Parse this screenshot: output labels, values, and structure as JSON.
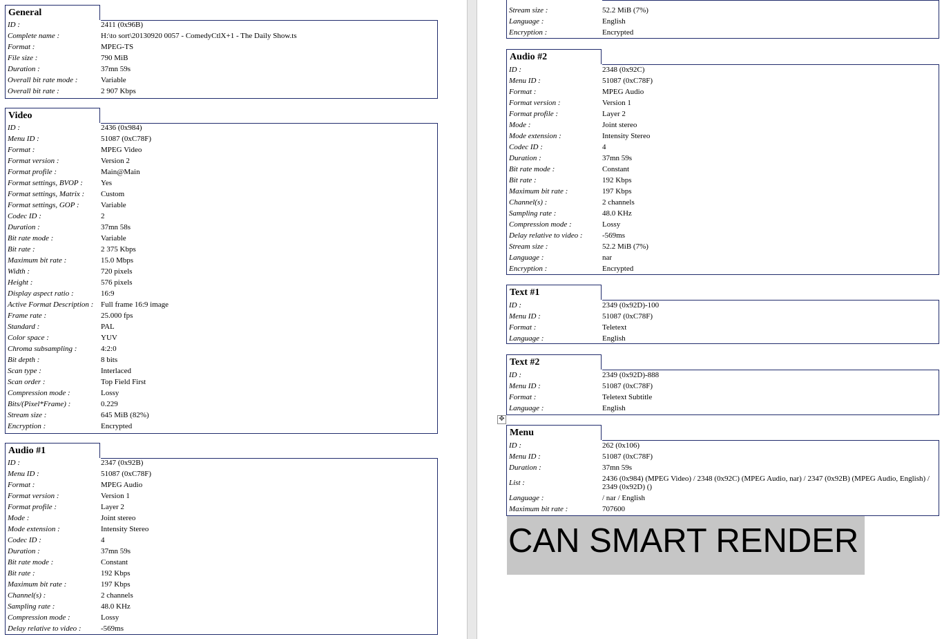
{
  "left_page": {
    "general": {
      "title": "General",
      "rows": [
        {
          "k": "ID :",
          "v": "2411 (0x96B)"
        },
        {
          "k": "Complete name :",
          "v": "H:\\to sort\\20130920 0057 - ComedyCtlX+1 - The Daily Show.ts"
        },
        {
          "k": "Format :",
          "v": "MPEG-TS"
        },
        {
          "k": "File size :",
          "v": "790 MiB"
        },
        {
          "k": "Duration :",
          "v": "37mn 59s"
        },
        {
          "k": "Overall bit rate mode :",
          "v": "Variable"
        },
        {
          "k": "Overall bit rate :",
          "v": "2 907 Kbps"
        }
      ]
    },
    "video": {
      "title": "Video",
      "rows": [
        {
          "k": "ID :",
          "v": "2436 (0x984)"
        },
        {
          "k": "Menu ID :",
          "v": "51087 (0xC78F)"
        },
        {
          "k": "Format :",
          "v": "MPEG Video"
        },
        {
          "k": "Format version :",
          "v": "Version 2"
        },
        {
          "k": "Format profile :",
          "v": "Main@Main"
        },
        {
          "k": "Format settings, BVOP :",
          "v": "Yes"
        },
        {
          "k": "Format settings, Matrix :",
          "v": "Custom"
        },
        {
          "k": "Format settings, GOP :",
          "v": "Variable"
        },
        {
          "k": "Codec ID :",
          "v": "2"
        },
        {
          "k": "Duration :",
          "v": "37mn 58s"
        },
        {
          "k": "Bit rate mode :",
          "v": "Variable"
        },
        {
          "k": "Bit rate :",
          "v": "2 375 Kbps"
        },
        {
          "k": "Maximum bit rate :",
          "v": "15.0 Mbps"
        },
        {
          "k": "Width :",
          "v": "720 pixels"
        },
        {
          "k": "Height :",
          "v": "576 pixels"
        },
        {
          "k": "Display aspect ratio :",
          "v": "16:9"
        },
        {
          "k": "Active Format Description :",
          "v": "Full frame 16:9 image"
        },
        {
          "k": "Frame rate :",
          "v": "25.000 fps"
        },
        {
          "k": "Standard :",
          "v": "PAL"
        },
        {
          "k": "Color space :",
          "v": "YUV"
        },
        {
          "k": "Chroma subsampling :",
          "v": "4:2:0"
        },
        {
          "k": "Bit depth :",
          "v": "8 bits"
        },
        {
          "k": "Scan type :",
          "v": "Interlaced"
        },
        {
          "k": "Scan order :",
          "v": "Top Field First"
        },
        {
          "k": "Compression mode :",
          "v": "Lossy"
        },
        {
          "k": "Bits/(Pixel*Frame) :",
          "v": "0.229"
        },
        {
          "k": "Stream size :",
          "v": "645 MiB (82%)"
        },
        {
          "k": "Encryption :",
          "v": "Encrypted"
        }
      ]
    },
    "audio1": {
      "title": "Audio #1",
      "rows": [
        {
          "k": "ID :",
          "v": "2347 (0x92B)"
        },
        {
          "k": "Menu ID :",
          "v": "51087 (0xC78F)"
        },
        {
          "k": "Format :",
          "v": "MPEG Audio"
        },
        {
          "k": "Format version :",
          "v": "Version 1"
        },
        {
          "k": "Format profile :",
          "v": "Layer 2"
        },
        {
          "k": "Mode :",
          "v": "Joint stereo"
        },
        {
          "k": "Mode extension :",
          "v": "Intensity Stereo"
        },
        {
          "k": "Codec ID :",
          "v": "4"
        },
        {
          "k": "Duration :",
          "v": "37mn 59s"
        },
        {
          "k": "Bit rate mode :",
          "v": "Constant"
        },
        {
          "k": "Bit rate :",
          "v": "192 Kbps"
        },
        {
          "k": "Maximum bit rate :",
          "v": "197 Kbps"
        },
        {
          "k": "Channel(s) :",
          "v": "2 channels"
        },
        {
          "k": "Sampling rate :",
          "v": "48.0 KHz"
        },
        {
          "k": "Compression mode :",
          "v": "Lossy"
        },
        {
          "k": "Delay relative to video :",
          "v": "-569ms"
        }
      ]
    }
  },
  "right_page": {
    "audio1_cont": {
      "rows": [
        {
          "k": "Stream size :",
          "v": "52.2 MiB (7%)"
        },
        {
          "k": "Language :",
          "v": "English"
        },
        {
          "k": "Encryption :",
          "v": "Encrypted"
        }
      ]
    },
    "audio2": {
      "title": "Audio #2",
      "rows": [
        {
          "k": "ID :",
          "v": "2348 (0x92C)"
        },
        {
          "k": "Menu ID :",
          "v": "51087 (0xC78F)"
        },
        {
          "k": "Format :",
          "v": "MPEG Audio"
        },
        {
          "k": "Format version :",
          "v": "Version 1"
        },
        {
          "k": "Format profile :",
          "v": "Layer 2"
        },
        {
          "k": "Mode :",
          "v": "Joint stereo"
        },
        {
          "k": "Mode extension :",
          "v": "Intensity Stereo"
        },
        {
          "k": "Codec ID :",
          "v": "4"
        },
        {
          "k": "Duration :",
          "v": "37mn 59s"
        },
        {
          "k": "Bit rate mode :",
          "v": "Constant"
        },
        {
          "k": "Bit rate :",
          "v": "192 Kbps"
        },
        {
          "k": "Maximum bit rate :",
          "v": "197 Kbps"
        },
        {
          "k": "Channel(s) :",
          "v": "2 channels"
        },
        {
          "k": "Sampling rate :",
          "v": "48.0 KHz"
        },
        {
          "k": "Compression mode :",
          "v": "Lossy"
        },
        {
          "k": "Delay relative to video :",
          "v": "-569ms"
        },
        {
          "k": "Stream size :",
          "v": "52.2 MiB (7%)"
        },
        {
          "k": "Language :",
          "v": "nar"
        },
        {
          "k": "Encryption :",
          "v": "Encrypted"
        }
      ]
    },
    "text1": {
      "title": "Text #1",
      "rows": [
        {
          "k": "ID :",
          "v": "2349 (0x92D)-100"
        },
        {
          "k": "Menu ID :",
          "v": "51087 (0xC78F)"
        },
        {
          "k": "Format :",
          "v": "Teletext"
        },
        {
          "k": "Language :",
          "v": "English"
        }
      ]
    },
    "text2": {
      "title": "Text #2",
      "rows": [
        {
          "k": "ID :",
          "v": "2349 (0x92D)-888"
        },
        {
          "k": "Menu ID :",
          "v": "51087 (0xC78F)"
        },
        {
          "k": "Format :",
          "v": "Teletext Subtitle"
        },
        {
          "k": "Language :",
          "v": "English"
        }
      ]
    },
    "menu": {
      "title": "Menu",
      "rows": [
        {
          "k": "ID :",
          "v": "262 (0x106)"
        },
        {
          "k": "Menu ID :",
          "v": "51087 (0xC78F)"
        },
        {
          "k": "Duration :",
          "v": "37mn 59s"
        },
        {
          "k": "List :",
          "v": "2436 (0x984) (MPEG Video) / 2348 (0x92C) (MPEG Audio, nar) / 2347 (0x92B) (MPEG Audio, English) / 2349 (0x92D) ()"
        },
        {
          "k": "Language :",
          "v": "/ nar / English"
        },
        {
          "k": "Maximum bit rate :",
          "v": "707600"
        }
      ]
    },
    "highlight_text": "CAN SMART RENDER"
  },
  "colors": {
    "border": "#1f2a6b",
    "highlight": "#c6c6c6",
    "gutter": "#e8e8e8"
  }
}
